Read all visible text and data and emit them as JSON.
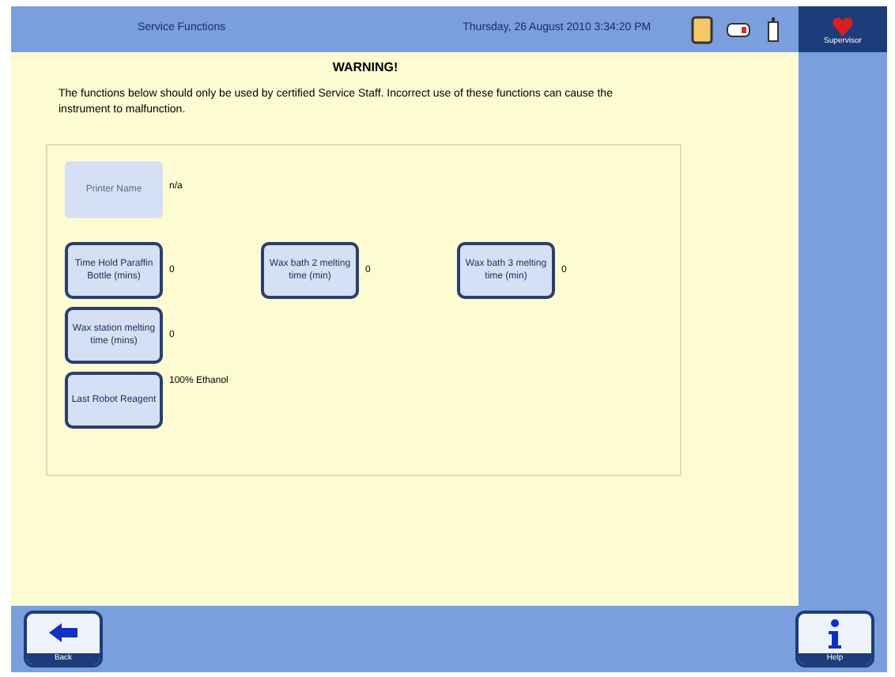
{
  "header": {
    "title": "Service Functions",
    "datetime": "Thursday, 26 August 2010 3:34:20 PM",
    "user": "Supervisor"
  },
  "warning": {
    "title": "WARNING!",
    "text": "The functions below should only be used by certified Service Staff. Incorrect use of these functions can cause the instrument to malfunction."
  },
  "rows": [
    {
      "items": [
        {
          "label": "Printer Name",
          "value": "n/a",
          "disabled": true
        }
      ]
    },
    {
      "items": [
        {
          "label": "Time Hold Paraffin Bottle (mins)",
          "value": "0",
          "disabled": false
        },
        {
          "label": "Wax bath 2 melting time (min)",
          "value": "0",
          "disabled": false
        },
        {
          "label": "Wax bath 3 melting time (min)",
          "value": "0",
          "disabled": false
        }
      ]
    },
    {
      "items": [
        {
          "label": "Wax station melting time (mins)",
          "value": "0",
          "disabled": false
        }
      ]
    },
    {
      "items": [
        {
          "label": "Last Robot Reagent",
          "value": "100% Ethanol",
          "disabled": false
        }
      ]
    }
  ],
  "footer": {
    "back": "Back",
    "help": "Help"
  }
}
